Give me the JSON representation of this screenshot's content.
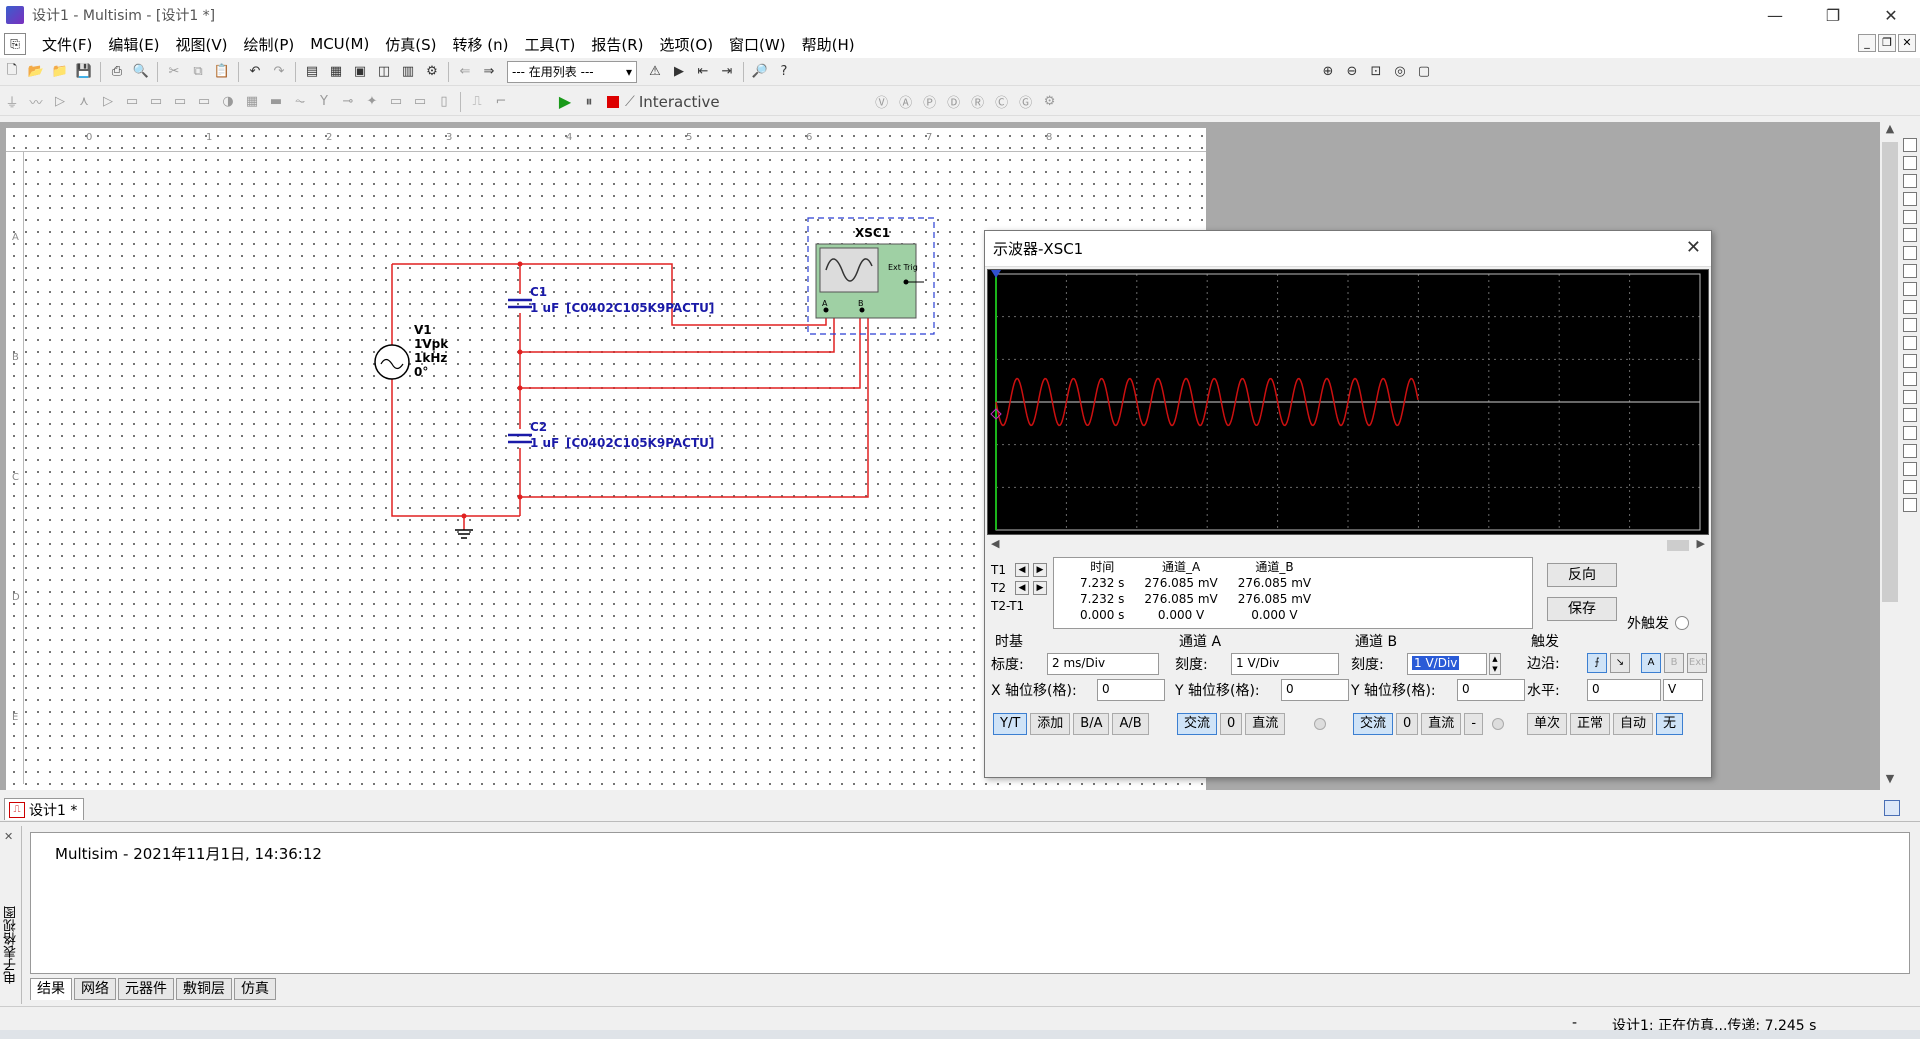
{
  "window": {
    "title": "设计1 - Multisim - [设计1 *]",
    "controls": [
      "—",
      "❐",
      "✕"
    ]
  },
  "menu": [
    "文件(F)",
    "编辑(E)",
    "视图(V)",
    "绘制(P)",
    "MCU(M)",
    "仿真(S)",
    "转移 (n)",
    "工具(T)",
    "报告(R)",
    "选项(O)",
    "窗口(W)",
    "帮助(H)"
  ],
  "mdi_controls": [
    "_",
    "❐",
    "✕"
  ],
  "toolbar": {
    "inuse_list": "--- 在用列表 ---",
    "interactive": "Interactive"
  },
  "ruler": {
    "columns": [
      "0",
      "1",
      "2",
      "3",
      "4",
      "5",
      "6",
      "7",
      "8"
    ],
    "rows": [
      "A",
      "B",
      "C",
      "D",
      "E"
    ]
  },
  "schematic": {
    "source": {
      "ref": "V1",
      "amplitude": "1Vpk",
      "frequency": "1kHz",
      "phase": "0°"
    },
    "c1": {
      "ref": "C1",
      "value": "1 uF",
      "part": "[C0402C105K9PACTU]"
    },
    "c2": {
      "ref": "C2",
      "value": "1 uF",
      "part": "[C0402C105K9PACTU]"
    },
    "scope": {
      "ref": "XSC1",
      "ext_trig": "Ext Trig",
      "pin_a": "A",
      "pin_b": "B"
    },
    "colors": {
      "wire": "#e02020",
      "component": "#1a1aa8",
      "scope_body": "#9fd0a4"
    }
  },
  "oscilloscope": {
    "title": "示波器-XSC1",
    "close": "✕",
    "trace_color": "#cc1010",
    "cursor_labels": [
      "T1",
      "T2",
      "T2-T1"
    ],
    "readout_headers": [
      "时间",
      "通道_A",
      "通道_B"
    ],
    "readout_rows": [
      [
        "7.232 s",
        "276.085 mV",
        "276.085 mV"
      ],
      [
        "7.232 s",
        "276.085 mV",
        "276.085 mV"
      ],
      [
        "0.000 s",
        "0.000 V",
        "0.000 V"
      ]
    ],
    "reverse_btn": "反向",
    "save_btn": "保存",
    "ext_trigger": "外触发",
    "timebase": {
      "title": "时基",
      "scale_label": "标度:",
      "scale": "2 ms/Div",
      "xpos_label": "X 轴位移(格):",
      "xpos": "0"
    },
    "timebase_modes": [
      "Y/T",
      "添加",
      "B/A",
      "A/B"
    ],
    "channel_a": {
      "title": "通道 A",
      "scale_label": "刻度:",
      "scale": "1 V/Div",
      "ypos_label": "Y 轴位移(格):",
      "ypos": "0"
    },
    "channel_b": {
      "title": "通道 B",
      "scale_label": "刻度:",
      "scale": "1 V/Div",
      "ypos_label": "Y 轴位移(格):",
      "ypos": "0"
    },
    "coupling": [
      "交流",
      "0",
      "直流"
    ],
    "channel_b_minus": "-",
    "trigger": {
      "title": "触发",
      "edge_label": "边沿:",
      "level_label": "水平:",
      "level": "0",
      "level_unit": "V",
      "sources": [
        "A",
        "B",
        "Ext"
      ],
      "modes": [
        "单次",
        "正常",
        "自动",
        "无"
      ]
    }
  },
  "doc_tab": "设计1 *",
  "side_panel_label": "电子表格视图",
  "log": {
    "text": "Multisim  -  2021年11月1日, 14:36:12"
  },
  "bottom_tabs": [
    "结果",
    "网络",
    "元器件",
    "敷铜层",
    "仿真"
  ],
  "status": {
    "dash": "-",
    "text": "设计1: 正在仿真...传递: 7.245 s"
  }
}
